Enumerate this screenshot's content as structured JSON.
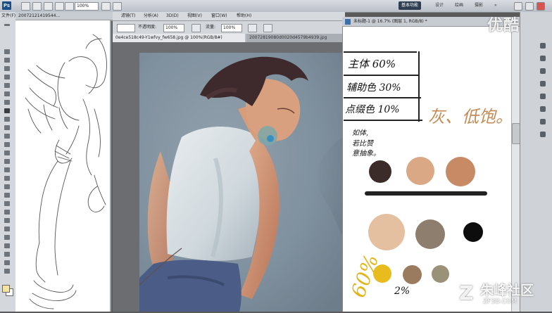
{
  "app": {
    "logo": "Ps",
    "zoom": "100%",
    "workspaces": [
      "基本功能",
      "设计",
      "绘画",
      "摄影"
    ],
    "workspace_more": "»",
    "window_controls": [
      "minimize-icon",
      "maximize-icon",
      "close-icon"
    ]
  },
  "menu": {
    "left_items": [
      "文件(F)"
    ],
    "items": [
      "滤镜(T)",
      "分析(A)",
      "3D(D)",
      "视图(V)",
      "窗口(W)",
      "帮助(H)"
    ]
  },
  "options": {
    "opacity_label": "不透明度:",
    "opacity_value": "100%",
    "flow_label": "流量:",
    "flow_value": "100%"
  },
  "documents": {
    "left_title": "20072121419544...",
    "tab_a": "0e4ce518c49-Y1wfvy_fw658.jpg @ 100%(RGB/8#)",
    "tab_b": "20072819080d0020d4579b4939.jpg",
    "right_title": "未标题-1 @ 16.7% (图层 1, RGB/8) *"
  },
  "notes": {
    "line1": "主体 60%",
    "line2": "辅助色 30%",
    "line3": "点缀色 10%",
    "ratio_right": "灰、低饱。",
    "small_note": [
      "如体, ",
      "若比赞",
      "意抽象。"
    ],
    "big_percent": "60%",
    "small_percent": "2%"
  },
  "palette": {
    "row1": [
      "#3b2b29",
      "#dba886",
      "#c88a64"
    ],
    "row2": [
      "#e4c0a0",
      "#8e7e6e",
      "#0d0d0d"
    ],
    "row3": [
      "#e8bb1e",
      "#9b7b5f",
      "#9a9278"
    ]
  },
  "watermarks": {
    "top": "优酷",
    "bottom_logo": "Z",
    "bottom_cn": "朱峰社区",
    "bottom_url": "ZF3D.COM"
  }
}
